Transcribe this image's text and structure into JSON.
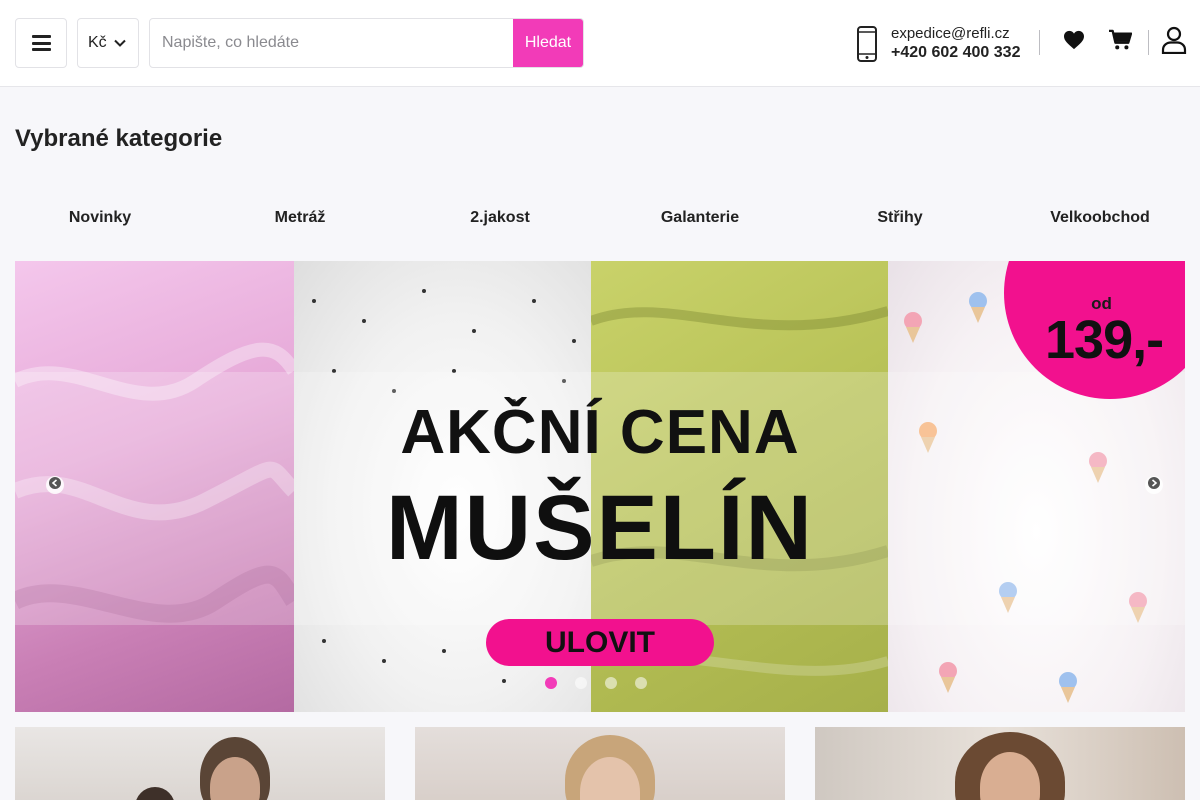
{
  "header": {
    "currency": "Kč",
    "search": {
      "placeholder": "Napište, co hledáte",
      "value": "",
      "button": "Hledat"
    },
    "contact": {
      "email": "expedice@refli.cz",
      "phone": "+420 602 400 332"
    },
    "icons": [
      "menu-icon",
      "chevron-down-icon",
      "phone-icon",
      "heart-icon",
      "cart-icon",
      "user-icon"
    ]
  },
  "categories": {
    "title": "Vybrané kategorie",
    "items": [
      "Novinky",
      "Metráž",
      "2.jakost",
      "Galanterie",
      "Střihy",
      "Velkoobchod"
    ]
  },
  "banner": {
    "price_prefix": "od",
    "price": "139,-",
    "line1": "AKČNÍ CENA",
    "line2": "MUŠELÍN",
    "cta": "ULOVIT",
    "slides": 4,
    "active_slide": 1
  },
  "colors": {
    "accent": "#f23bb8",
    "banner_pink": "#f2118e",
    "text": "#222222"
  }
}
